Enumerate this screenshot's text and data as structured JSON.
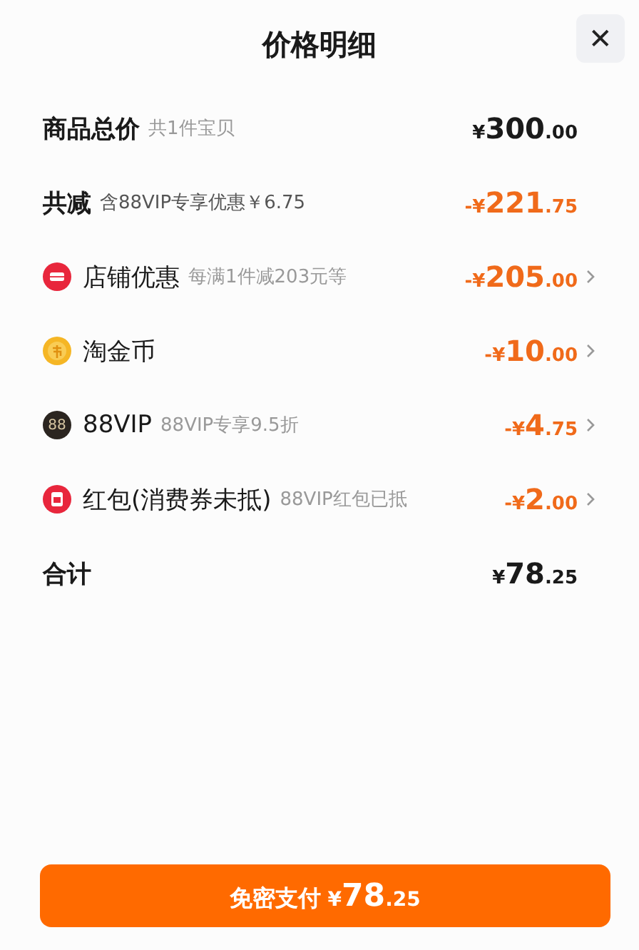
{
  "header": {
    "title": "价格明细",
    "close": "✕"
  },
  "rows": [
    {
      "kind": "summary",
      "label": "商品总价",
      "note": "共1件宝贝",
      "amount": "¥300.00",
      "highlight": false,
      "arrow": false
    },
    {
      "kind": "summary",
      "label": "共减",
      "note": "含88VIP专享优惠￥6.75",
      "amount": "-¥221.75",
      "highlight": true,
      "arrow": false
    },
    {
      "kind": "shop",
      "label": "店铺优惠",
      "note": "每满1件减203元等",
      "amount": "-¥205.00",
      "highlight": true,
      "arrow": true
    },
    {
      "kind": "coin",
      "label": "淘金币",
      "amount": "-¥10.00",
      "highlight": true,
      "arrow": true
    },
    {
      "kind": "vip",
      "icon_text": "88",
      "label": "88VIP",
      "note": "88VIP专享9.5折",
      "amount": "-¥4.75",
      "highlight": true,
      "arrow": true
    },
    {
      "kind": "envelope",
      "label": "红包(消费券未抵)",
      "note": "88VIP红包已抵",
      "amount": "-¥2.00",
      "highlight": true,
      "arrow": true
    },
    {
      "kind": "total",
      "label": "合计",
      "amount": "¥78.25",
      "highlight": false,
      "arrow": false
    }
  ],
  "pay_button": {
    "label": "免密支付",
    "amount": "¥78.25"
  }
}
